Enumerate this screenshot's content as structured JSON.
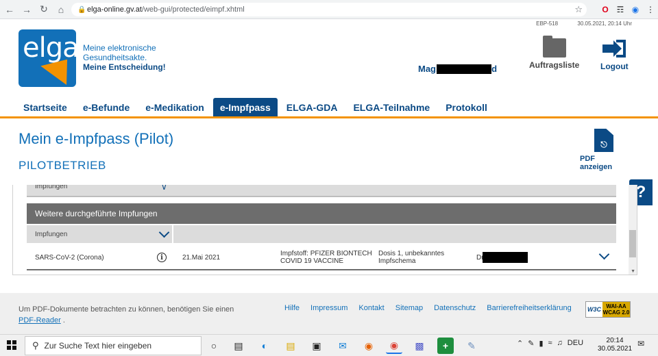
{
  "browser": {
    "url_host": "elga-online.gv.at",
    "url_path": "/web-gui/protected/eimpf.xhtml"
  },
  "header": {
    "logo_text": "elga",
    "tagline_1": "Meine elektronische",
    "tagline_2": "Gesundheitsakte.",
    "tagline_3": "Meine Entscheidung!",
    "server_id": "EBP-518",
    "timestamp": "30.05.2021, 20:14 Uhr",
    "user_name": "Mag. T",
    "user_name_end": "d",
    "orders_label": "Auftragsliste",
    "logout_label": "Logout"
  },
  "nav": {
    "items": [
      "Startseite",
      "e-Befunde",
      "e-Medikation",
      "e-Impfpass",
      "ELGA-GDA",
      "ELGA-Teilnahme",
      "Protokoll"
    ],
    "active": "e-Impfpass"
  },
  "page": {
    "title": "Mein e-Impfpass (Pilot)",
    "subtitle": "PILOTBETRIEB",
    "pdf_label": "PDF anzeigen",
    "help_label": "?"
  },
  "table": {
    "cut_row_label": "Impfungen",
    "section_title": "Weitere durchgeführte Impfungen",
    "filter_label": "Impfungen",
    "row": {
      "disease": "SARS-CoV-2 (Corona)",
      "date": "21.Mai 2021",
      "vaccine_line1": "Impfstoff: PFIZER BIONTECH",
      "vaccine_line2": "COVID 19 VACCINE",
      "dose_line1": "Dosis 1, unbekanntes",
      "dose_line2": "Impfschema",
      "doctor_prefix": "Dr."
    }
  },
  "footer": {
    "note": "Um PDF-Dokumente betrachten zu können, benötigen Sie einen",
    "pdf_reader": "PDF-Reader",
    "pdf_reader_suffix": ".",
    "links": [
      "Hilfe",
      "Impressum",
      "Kontakt",
      "Sitemap",
      "Datenschutz",
      "Barrierefreiheitserklärung"
    ],
    "badge_w3c": "W3C",
    "badge_line1": "WAI-AA",
    "badge_line2": "WCAG 2.0"
  },
  "taskbar": {
    "search_placeholder": "Zur Suche Text hier eingeben",
    "language": "DEU",
    "time": "20:14",
    "date": "30.05.2021"
  },
  "colors": {
    "brand_blue": "#0b4a85",
    "logo_blue": "#1270b8",
    "accent_orange": "#f39200",
    "section_gray": "#6d6d6d"
  },
  "icons": [
    "back-icon",
    "forward-icon",
    "reload-icon",
    "home-icon",
    "lock-icon",
    "star-icon",
    "folder-icon",
    "logout-icon",
    "pdf-icon",
    "info-icon",
    "chevron-down-icon",
    "windows-icon",
    "search-icon"
  ]
}
